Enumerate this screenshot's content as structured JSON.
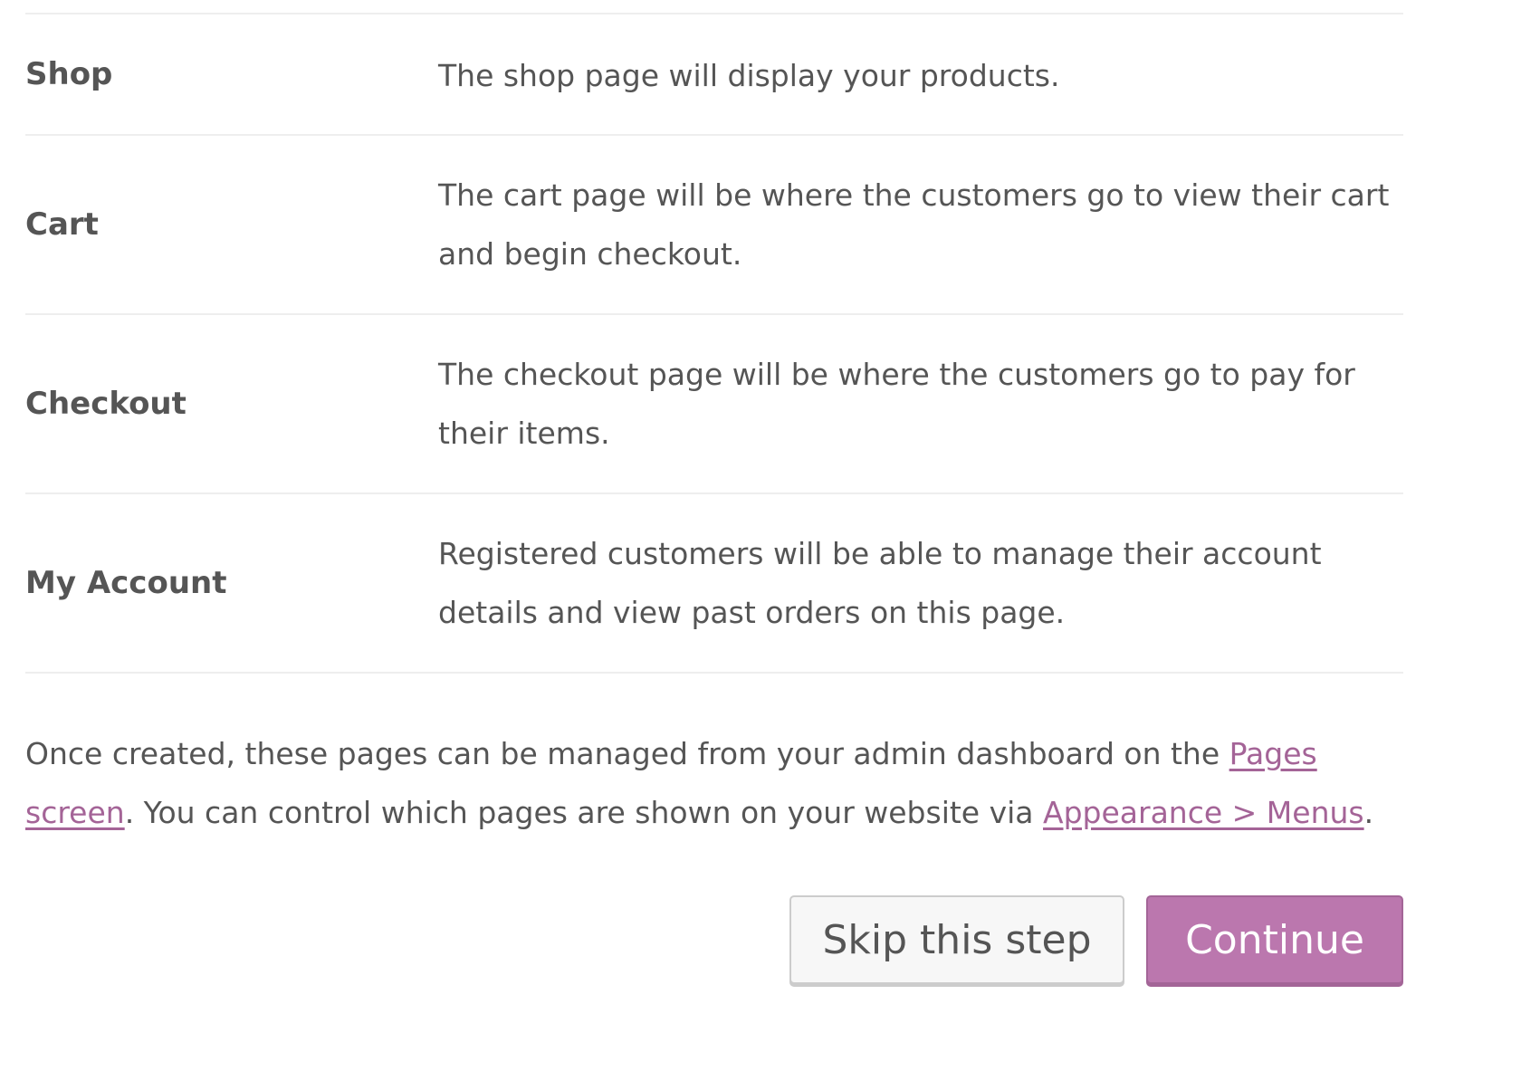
{
  "pages": [
    {
      "name": "Shop",
      "description": "The shop page will display your products."
    },
    {
      "name": "Cart",
      "description": "The cart page will be where the customers go to view their cart and begin checkout."
    },
    {
      "name": "Checkout",
      "description": "The checkout page will be where the customers go to pay for their items."
    },
    {
      "name": "My Account",
      "description": "Registered customers will be able to manage their account details and view past orders on this page."
    }
  ],
  "note": {
    "before_pages_link": "Once created, these pages can be managed from your admin dashboard on the ",
    "pages_link": "Pages screen",
    "middle": ". You can control which pages are shown on your website via ",
    "menus_link": "Appearance > Menus",
    "after": "."
  },
  "actions": {
    "skip_label": "Skip this step",
    "continue_label": "Continue"
  },
  "colors": {
    "text": "#555555",
    "link": "#a46497",
    "primary_button": "#bb77ae",
    "divider": "#eeeeee"
  }
}
